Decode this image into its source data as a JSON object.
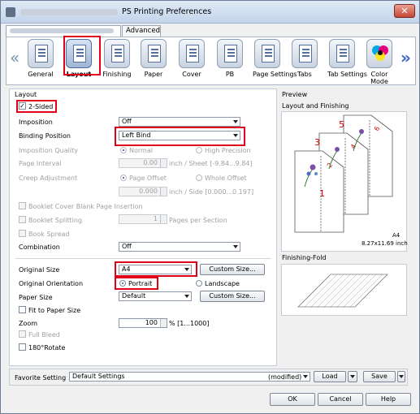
{
  "window": {
    "title": "PS Printing Preferences",
    "close_label": "✕"
  },
  "tabs": [
    {
      "label": "",
      "selected": true
    },
    {
      "label": "Advanced",
      "selected": false
    }
  ],
  "toolbar": {
    "items": [
      {
        "label": "General",
        "icon": "general-icon"
      },
      {
        "label": "Layout",
        "icon": "layout-icon",
        "selected": true
      },
      {
        "label": "Finishing",
        "icon": "finishing-icon"
      },
      {
        "label": "Paper",
        "icon": "paper-icon"
      },
      {
        "label": "Cover",
        "icon": "cover-icon"
      },
      {
        "label": "PB",
        "icon": "pb-icon"
      },
      {
        "label": "Page Settings",
        "icon": "page-settings-icon"
      },
      {
        "label": "Tabs",
        "icon": "tabs-icon"
      },
      {
        "label": "Tab Settings",
        "icon": "tab-settings-icon"
      },
      {
        "label": "Color Mode",
        "icon": "color-mode-icon"
      }
    ]
  },
  "layout": {
    "group_title": "Layout",
    "two_sided": {
      "label": "2-Sided",
      "checked": true
    },
    "imposition": {
      "label": "Imposition",
      "value": "Off"
    },
    "binding_position": {
      "label": "Binding Position",
      "value": "Left Bind"
    },
    "imposition_quality": {
      "label": "Imposition Quality",
      "opt1": "Normal",
      "opt2": "High Precision"
    },
    "page_interval": {
      "label": "Page Interval",
      "value": "0.00",
      "unit": "inch / Sheet [-9.84...9.84]"
    },
    "creep_adjustment": {
      "label": "Creep Adjustment",
      "opt1": "Page Offset",
      "opt2": "Whole Offset",
      "value": "0.000",
      "unit": "inch / Side [0.000...0.197]"
    },
    "booklet_cover_blank": {
      "label": "Booklet Cover Blank Page Insertion"
    },
    "booklet_splitting": {
      "label": "Booklet Splitting",
      "value": "1",
      "unit": "Pages per Section"
    },
    "book_spread": {
      "label": "Book Spread"
    },
    "combination": {
      "label": "Combination",
      "value": "Off"
    },
    "original_size": {
      "label": "Original Size",
      "value": "A4",
      "button": "Custom Size..."
    },
    "original_orientation": {
      "label": "Original Orientation",
      "opt1": "Portrait",
      "opt2": "Landscape"
    },
    "paper_size": {
      "label": "Paper Size",
      "value": "Default",
      "button": "Custom Size..."
    },
    "fit_to_paper": {
      "label": "Fit to Paper Size"
    },
    "zoom": {
      "label": "Zoom",
      "value": "100",
      "unit": "% [1...1000]"
    },
    "full_bleed": {
      "label": "Full Bleed"
    },
    "rotate": {
      "label": "180°Rotate"
    }
  },
  "preview": {
    "title": "Preview",
    "layout_finishing": "Layout and Finishing",
    "pages": [
      "1",
      "2",
      "3",
      "4",
      "5",
      "6"
    ],
    "paper_name": "A4",
    "paper_dims": "8.27x11.69 inch",
    "finishing_fold": "Finishing-Fold"
  },
  "favorite": {
    "label": "Favorite Setting",
    "value": "Default Settings",
    "modified": "(modified)",
    "load": "Load",
    "save": "Save"
  },
  "buttons": {
    "ok": "OK",
    "cancel": "Cancel",
    "help": "Help"
  }
}
